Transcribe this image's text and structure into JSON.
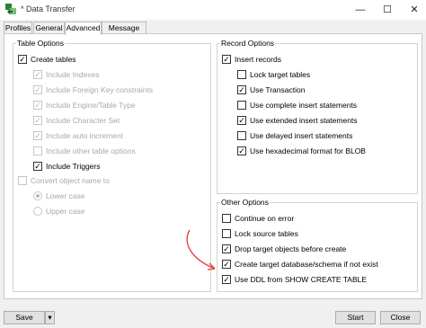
{
  "window": {
    "title": "* Data Transfer",
    "minimize": "—",
    "maximize": "☐",
    "close": "✕"
  },
  "tabs": [
    {
      "label": "Profiles",
      "active": false
    },
    {
      "label": "General",
      "active": false
    },
    {
      "label": "Advanced",
      "active": true
    },
    {
      "label": "Message Log",
      "active": false
    }
  ],
  "table_options": {
    "title": "Table Options",
    "items": [
      {
        "label": "Create tables",
        "checked": true,
        "enabled": true
      },
      {
        "label": "Include Indexes",
        "checked": true,
        "enabled": false
      },
      {
        "label": "Include Foreign Key constraints",
        "checked": true,
        "enabled": false
      },
      {
        "label": "Include Engine/Table Type",
        "checked": true,
        "enabled": false
      },
      {
        "label": "Include Character Set",
        "checked": true,
        "enabled": false
      },
      {
        "label": "Include auto increment",
        "checked": true,
        "enabled": false
      },
      {
        "label": "Include other table options",
        "checked": false,
        "enabled": false
      },
      {
        "label": "Include Triggers",
        "checked": true,
        "enabled": true
      },
      {
        "label": "Convert object name to",
        "checked": false,
        "enabled": false
      }
    ],
    "case_options": [
      {
        "label": "Lower case",
        "selected": true,
        "enabled": false
      },
      {
        "label": "Upper case",
        "selected": false,
        "enabled": false
      }
    ]
  },
  "record_options": {
    "title": "Record Options",
    "items": [
      {
        "label": "Insert records",
        "checked": true
      },
      {
        "label": "Lock target tables",
        "checked": false
      },
      {
        "label": "Use Transaction",
        "checked": true
      },
      {
        "label": "Use complete insert statements",
        "checked": false
      },
      {
        "label": "Use extended insert statements",
        "checked": true
      },
      {
        "label": "Use delayed insert statements",
        "checked": false
      },
      {
        "label": "Use hexadecimal format for BLOB",
        "checked": true
      }
    ]
  },
  "other_options": {
    "title": "Other Options",
    "items": [
      {
        "label": "Continue on error",
        "checked": false
      },
      {
        "label": "Lock source tables",
        "checked": false
      },
      {
        "label": "Drop target objects before create",
        "checked": true
      },
      {
        "label": "Create target database/schema if not exist",
        "checked": true
      },
      {
        "label": "Use DDL from SHOW CREATE TABLE",
        "checked": true
      }
    ]
  },
  "footer": {
    "save_label": "Save",
    "start_label": "Start",
    "close_label": "Close"
  },
  "colors": {
    "annotation_arrow": "#e53935",
    "app_icon": "#2e7d32"
  },
  "glyphs": {
    "check": "✓",
    "dropdown": "▾"
  }
}
